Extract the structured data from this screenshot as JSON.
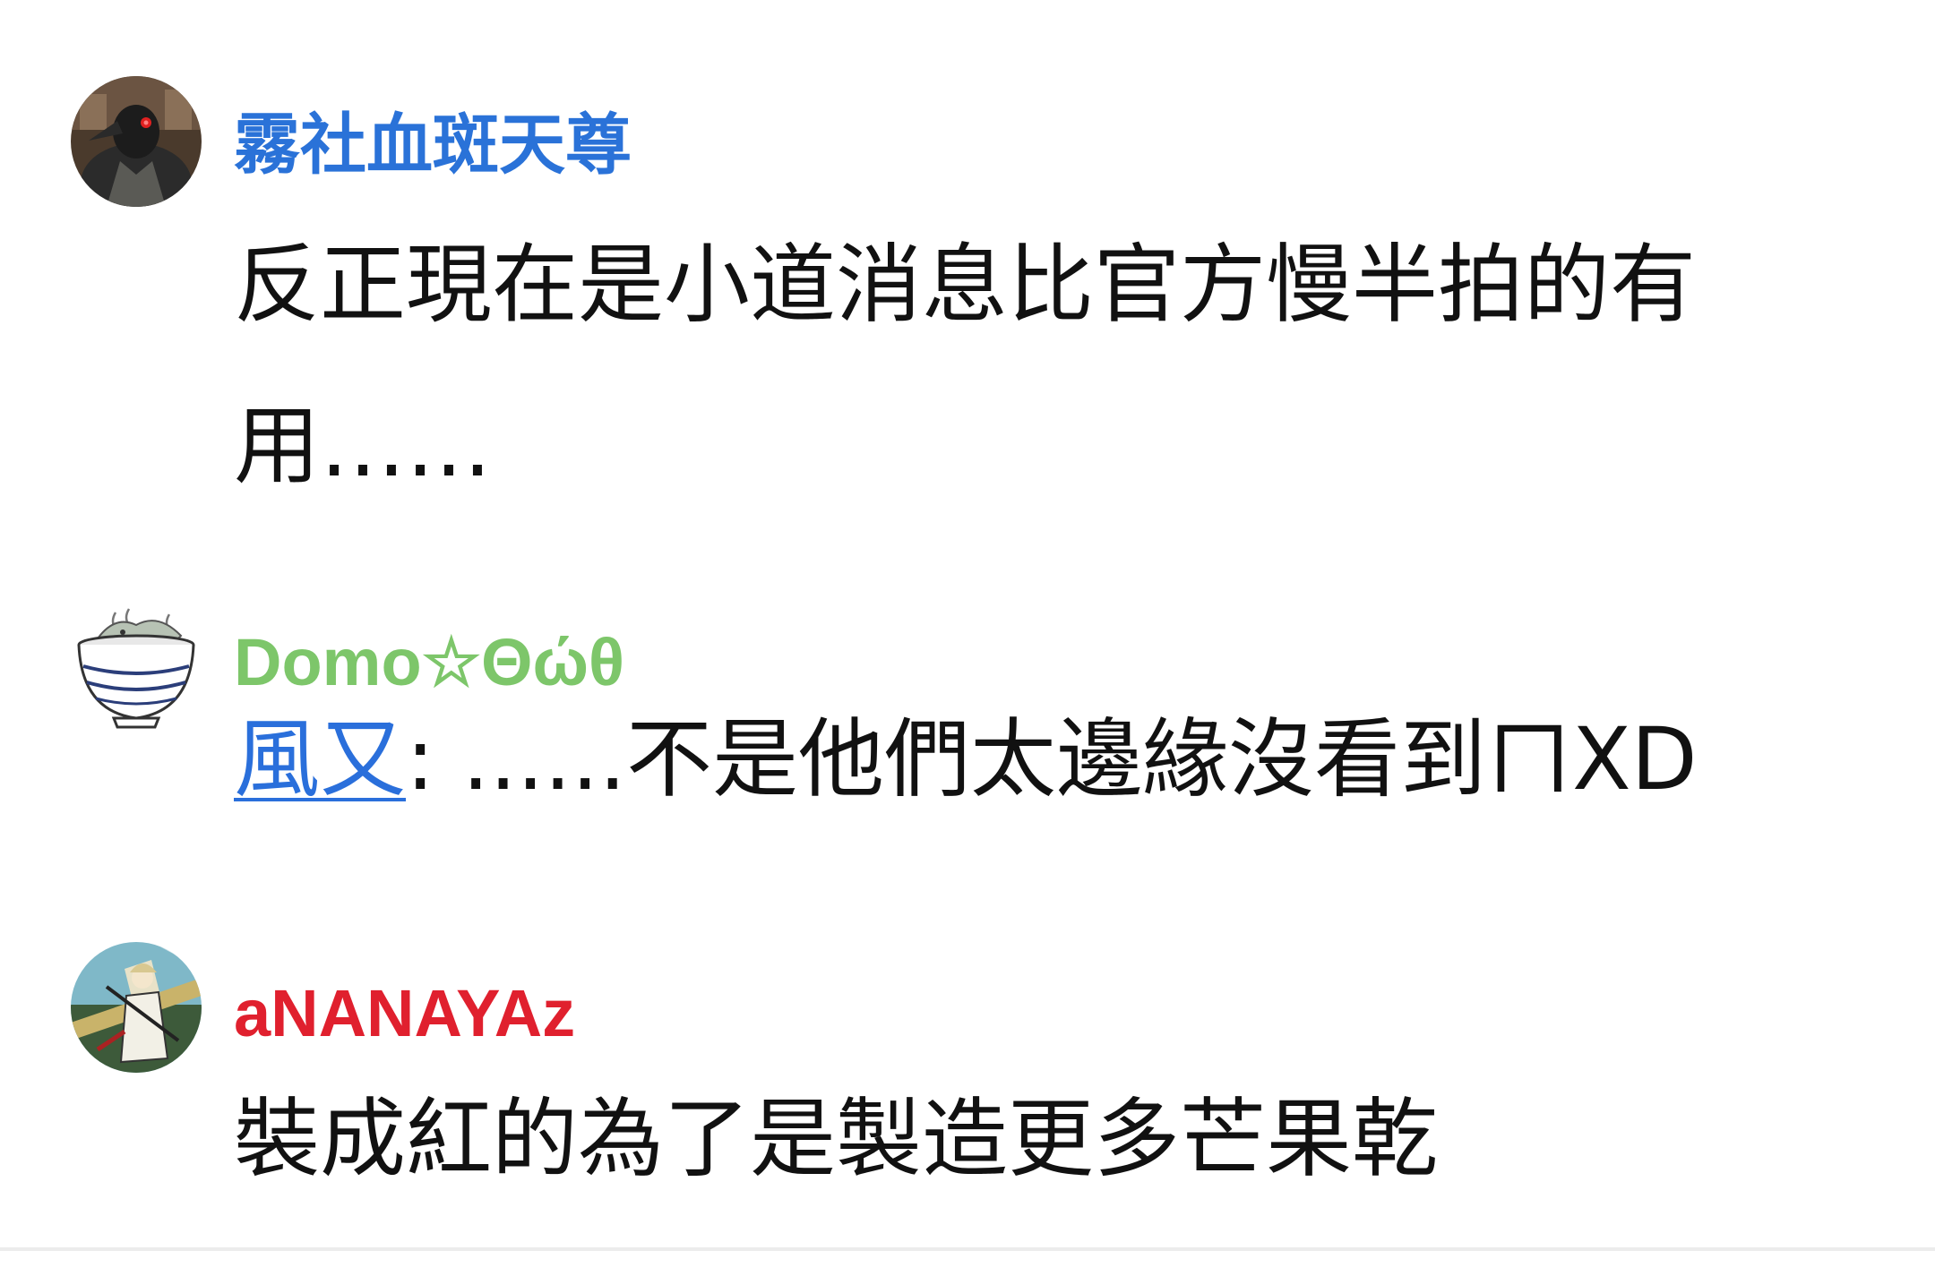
{
  "comments": [
    {
      "username": "霧社血斑天尊",
      "username_color": "#2a72d8",
      "avatar_icon": "crow-avatar-icon",
      "text": "反正現在是小道消息比官方慢半拍的有用……"
    },
    {
      "username": "Domo☆Θώθ",
      "username_color": "#7dc66a",
      "avatar_icon": "bowl-avatar-icon",
      "mention": "風又",
      "text": ": ......不是他們太邊緣沒看到ㄇXD"
    },
    {
      "username": "aNANAYAz",
      "username_color": "#e0202e",
      "avatar_icon": "anime-character-avatar-icon",
      "text": "裝成紅的為了是製造更多芒果乾"
    }
  ]
}
